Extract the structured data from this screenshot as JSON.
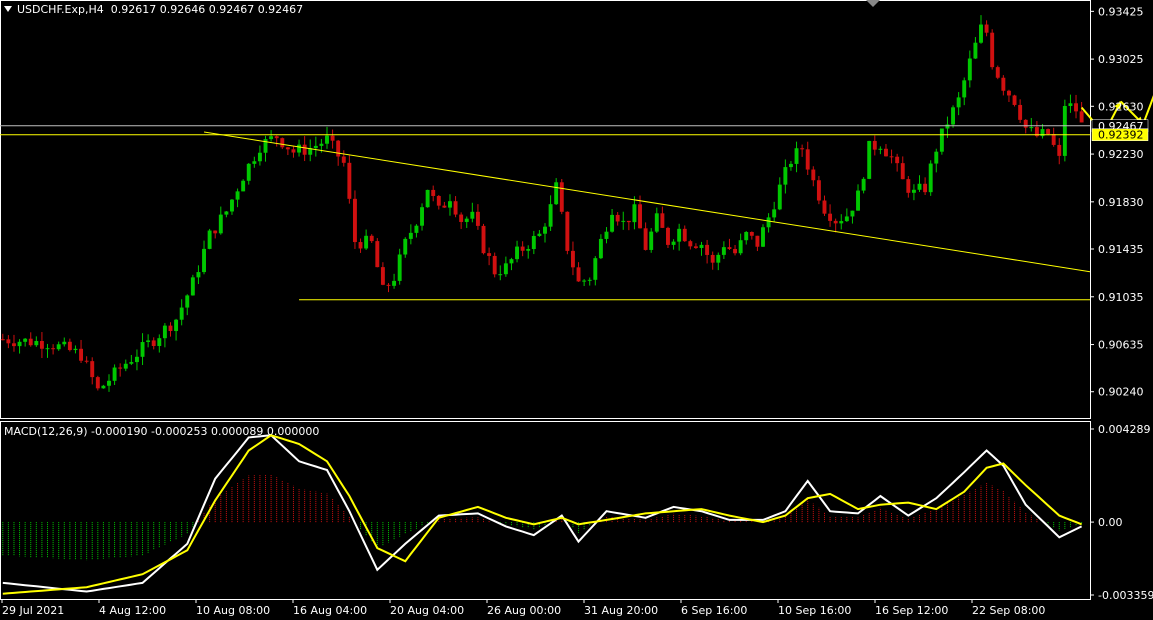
{
  "header": {
    "symbol": "USDCHF.Exp,H4",
    "ohlc": "0.92617 0.92646 0.92467 0.92467"
  },
  "macd": {
    "label": "MACD(12,26,9) -0.000190 -0.000253 0.000089 0.000000"
  },
  "colors": {
    "bull": "#00c800",
    "bear": "#d01010",
    "signal": "#ffff00",
    "macd_line": "#ffffff",
    "trendline": "#ffff00",
    "price_line": "#c0c0c0",
    "axis": "#ffffff"
  },
  "chart_data": [
    {
      "type": "candlestick",
      "y_ticks": [
        "0.93425",
        "0.93025",
        "0.92630",
        "0.92230",
        "0.91830",
        "0.91435",
        "0.91035",
        "0.90635",
        "0.90240"
      ],
      "ylim": [
        0.9002,
        0.9352
      ],
      "x_tick_labels": [
        "29 Jul 2021",
        "4 Aug 12:00",
        "10 Aug 08:00",
        "16 Aug 04:00",
        "20 Aug 04:00",
        "26 Aug 00:00",
        "31 Aug 20:00",
        "6 Sep 16:00",
        "10 Sep 16:00",
        "16 Sep 12:00",
        "22 Sep 08:00"
      ],
      "current_price": "0.92467",
      "highlight_price": "0.92392",
      "close_path": [
        [
          0,
          0.9068
        ],
        [
          8,
          0.9065
        ],
        [
          14,
          0.9055
        ],
        [
          17,
          0.9025
        ],
        [
          22,
          0.9048
        ],
        [
          27,
          0.9068
        ],
        [
          31,
          0.9085
        ],
        [
          34,
          0.9115
        ],
        [
          37,
          0.9155
        ],
        [
          40,
          0.9175
        ],
        [
          43,
          0.9205
        ],
        [
          46,
          0.923
        ],
        [
          49,
          0.9238
        ],
        [
          52,
          0.9225
        ],
        [
          55,
          0.9228
        ],
        [
          58,
          0.9235
        ],
        [
          61,
          0.9215
        ],
        [
          63,
          0.915
        ],
        [
          66,
          0.9148
        ],
        [
          68,
          0.9108
        ],
        [
          70,
          0.912
        ],
        [
          72,
          0.9148
        ],
        [
          74,
          0.9168
        ],
        [
          76,
          0.9195
        ],
        [
          78,
          0.9175
        ],
        [
          80,
          0.9188
        ],
        [
          82,
          0.9168
        ],
        [
          84,
          0.917
        ],
        [
          86,
          0.9145
        ],
        [
          88,
          0.9125
        ],
        [
          90,
          0.9128
        ],
        [
          92,
          0.914
        ],
        [
          94,
          0.9148
        ],
        [
          96,
          0.9155
        ],
        [
          98,
          0.9178
        ],
        [
          99,
          0.9195
        ],
        [
          101,
          0.9145
        ],
        [
          103,
          0.9115
        ],
        [
          105,
          0.912
        ],
        [
          107,
          0.915
        ],
        [
          109,
          0.9178
        ],
        [
          111,
          0.9165
        ],
        [
          113,
          0.9175
        ],
        [
          115,
          0.9145
        ],
        [
          117,
          0.9168
        ],
        [
          119,
          0.915
        ],
        [
          121,
          0.916
        ],
        [
          123,
          0.915
        ],
        [
          125,
          0.9148
        ],
        [
          127,
          0.913
        ],
        [
          129,
          0.9148
        ],
        [
          131,
          0.914
        ],
        [
          133,
          0.9155
        ],
        [
          135,
          0.9148
        ],
        [
          137,
          0.917
        ],
        [
          139,
          0.9195
        ],
        [
          141,
          0.9218
        ],
        [
          143,
          0.9228
        ],
        [
          145,
          0.92
        ],
        [
          147,
          0.9178
        ],
        [
          149,
          0.9168
        ],
        [
          151,
          0.9172
        ],
        [
          153,
          0.9188
        ],
        [
          155,
          0.9228
        ],
        [
          157,
          0.9232
        ],
        [
          159,
          0.922
        ],
        [
          161,
          0.92
        ],
        [
          163,
          0.919
        ],
        [
          165,
          0.9195
        ],
        [
          167,
          0.9228
        ],
        [
          169,
          0.925
        ],
        [
          171,
          0.9268
        ],
        [
          173,
          0.93
        ],
        [
          175,
          0.9328
        ],
        [
          176,
          0.9325
        ],
        [
          177,
          0.93
        ],
        [
          179,
          0.928
        ],
        [
          181,
          0.9268
        ],
        [
          183,
          0.9245
        ],
        [
          185,
          0.9238
        ],
        [
          187,
          0.924
        ],
        [
          189,
          0.9218
        ],
        [
          190,
          0.9265
        ],
        [
          192,
          0.926
        ],
        [
          193,
          0.9247
        ]
      ]
    },
    {
      "type": "line",
      "name": "MACD",
      "y_ticks": [
        "0.004289",
        "0.00",
        "-0.003359"
      ],
      "ylim": [
        -0.003359,
        0.004289
      ],
      "macd": [
        [
          0,
          -0.0028
        ],
        [
          15,
          -0.0032
        ],
        [
          25,
          -0.0028
        ],
        [
          33,
          -0.001
        ],
        [
          38,
          0.002
        ],
        [
          44,
          0.0039
        ],
        [
          48,
          0.004
        ],
        [
          53,
          0.0028
        ],
        [
          58,
          0.0024
        ],
        [
          62,
          0.0005
        ],
        [
          67,
          -0.0022
        ],
        [
          72,
          -0.001
        ],
        [
          78,
          0.0003
        ],
        [
          85,
          0.0004
        ],
        [
          90,
          -0.0002
        ],
        [
          95,
          -0.0006
        ],
        [
          100,
          0.0003
        ],
        [
          103,
          -0.0009
        ],
        [
          108,
          0.0005
        ],
        [
          115,
          0.0002
        ],
        [
          120,
          0.0007
        ],
        [
          125,
          0.0005
        ],
        [
          130,
          0.0001
        ],
        [
          136,
          0.0001
        ],
        [
          140,
          0.0005
        ],
        [
          144,
          0.0019
        ],
        [
          148,
          0.0005
        ],
        [
          153,
          0.0004
        ],
        [
          157,
          0.0012
        ],
        [
          162,
          0.0003
        ],
        [
          167,
          0.0011
        ],
        [
          172,
          0.0023
        ],
        [
          176,
          0.0033
        ],
        [
          179,
          0.0026
        ],
        [
          183,
          0.0008
        ],
        [
          189,
          -0.0007
        ],
        [
          193,
          -0.0002
        ]
      ],
      "signal": [
        [
          0,
          -0.0033
        ],
        [
          15,
          -0.003
        ],
        [
          25,
          -0.0024
        ],
        [
          33,
          -0.0013
        ],
        [
          38,
          0.001
        ],
        [
          44,
          0.0033
        ],
        [
          48,
          0.004
        ],
        [
          53,
          0.0036
        ],
        [
          58,
          0.0028
        ],
        [
          62,
          0.0012
        ],
        [
          67,
          -0.0012
        ],
        [
          72,
          -0.0018
        ],
        [
          78,
          0.0002
        ],
        [
          85,
          0.0007
        ],
        [
          90,
          0.0002
        ],
        [
          95,
          -0.0001
        ],
        [
          100,
          0.0002
        ],
        [
          103,
          -0.0001
        ],
        [
          108,
          0.0001
        ],
        [
          115,
          0.0004
        ],
        [
          120,
          0.0005
        ],
        [
          125,
          0.0006
        ],
        [
          130,
          0.0003
        ],
        [
          136,
          0.0
        ],
        [
          140,
          0.0003
        ],
        [
          144,
          0.0011
        ],
        [
          148,
          0.0013
        ],
        [
          153,
          0.0006
        ],
        [
          157,
          0.0008
        ],
        [
          162,
          0.0009
        ],
        [
          167,
          0.0006
        ],
        [
          172,
          0.0014
        ],
        [
          176,
          0.0025
        ],
        [
          179,
          0.0027
        ],
        [
          183,
          0.0017
        ],
        [
          189,
          0.0003
        ],
        [
          193,
          -0.0001
        ]
      ]
    }
  ]
}
